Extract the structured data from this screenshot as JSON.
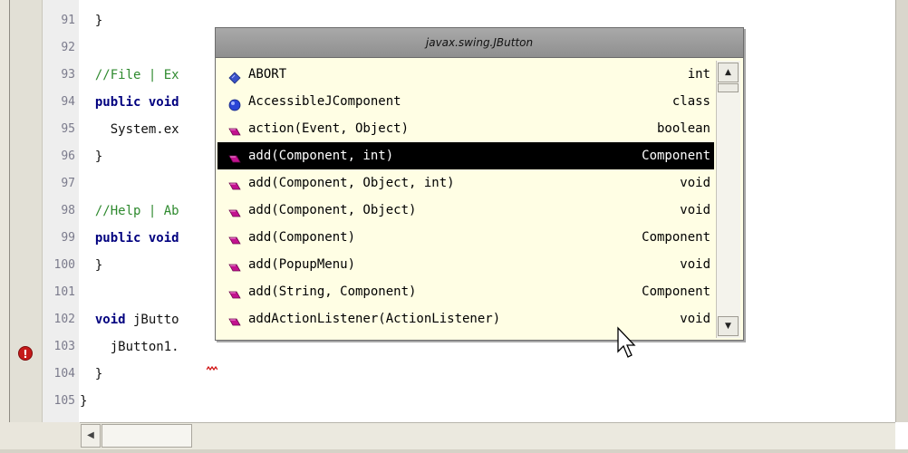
{
  "editor": {
    "lines": [
      {
        "num": "91",
        "parts": [
          {
            "cls": "txt",
            "text": "  }"
          }
        ]
      },
      {
        "num": "92",
        "parts": []
      },
      {
        "num": "93",
        "parts": [
          {
            "cls": "cmt",
            "text": "  //File | Ex"
          }
        ]
      },
      {
        "num": "94",
        "parts": [
          {
            "cls": "kw",
            "text": "  public void"
          }
        ]
      },
      {
        "num": "95",
        "parts": [
          {
            "cls": "txt",
            "text": "    System.ex"
          }
        ]
      },
      {
        "num": "96",
        "parts": [
          {
            "cls": "txt",
            "text": "  }"
          }
        ]
      },
      {
        "num": "97",
        "parts": []
      },
      {
        "num": "98",
        "parts": [
          {
            "cls": "cmt",
            "text": "  //Help | Ab"
          }
        ]
      },
      {
        "num": "99",
        "parts": [
          {
            "cls": "kw",
            "text": "  public void"
          }
        ]
      },
      {
        "num": "100",
        "parts": [
          {
            "cls": "txt",
            "text": "  }"
          }
        ]
      },
      {
        "num": "101",
        "parts": []
      },
      {
        "num": "102",
        "parts": [
          {
            "cls": "kw",
            "text": "  void"
          },
          {
            "cls": "txt",
            "text": " jButto"
          }
        ]
      },
      {
        "num": "103",
        "parts": [
          {
            "cls": "txt",
            "text": "    jButton1."
          }
        ]
      },
      {
        "num": "104",
        "parts": [
          {
            "cls": "txt",
            "text": "  }"
          }
        ]
      },
      {
        "num": "105",
        "parts": [
          {
            "cls": "txt",
            "text": "}"
          }
        ]
      }
    ],
    "error_marker": "!",
    "error_line": "103"
  },
  "popup": {
    "title": "javax.swing.JButton",
    "selected_index": 3,
    "items": [
      {
        "icon": "field-icon",
        "name": "ABORT",
        "type": "int"
      },
      {
        "icon": "class-icon",
        "name": "AccessibleJComponent",
        "type": "class"
      },
      {
        "icon": "method-icon",
        "name": "action(Event, Object)",
        "type": "boolean"
      },
      {
        "icon": "method-icon",
        "name": "add(Component, int)",
        "type": "Component"
      },
      {
        "icon": "method-icon",
        "name": "add(Component, Object, int)",
        "type": "void"
      },
      {
        "icon": "method-icon",
        "name": "add(Component, Object)",
        "type": "void"
      },
      {
        "icon": "method-icon",
        "name": "add(Component)",
        "type": "Component"
      },
      {
        "icon": "method-icon",
        "name": "add(PopupMenu)",
        "type": "void"
      },
      {
        "icon": "method-icon",
        "name": "add(String, Component)",
        "type": "Component"
      },
      {
        "icon": "method-icon",
        "name": "addActionListener(ActionListener)",
        "type": "void"
      }
    ]
  },
  "colors": {
    "comment": "#2f8a2f",
    "keyword": "#00007f",
    "popup_bg": "#fffee4",
    "method_icon": "#c2128f",
    "field_icon": "#3a52c8",
    "class_icon": "#2a45d6"
  }
}
